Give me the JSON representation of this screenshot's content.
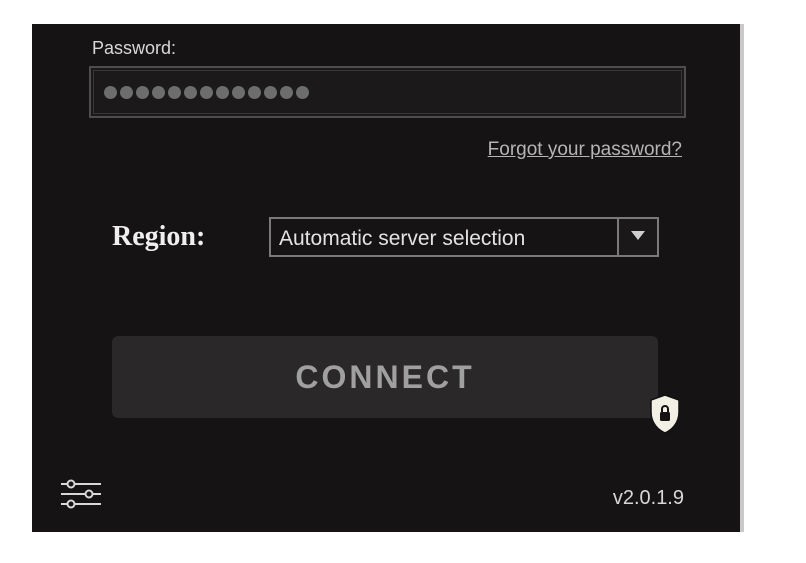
{
  "password": {
    "label": "Password:",
    "mask_length": 13,
    "forgot_link": "Forgot your password?"
  },
  "region": {
    "label": "Region:",
    "selected": "Automatic server selection"
  },
  "connect": {
    "label": "CONNECT"
  },
  "footer": {
    "version": "v2.0.1.9"
  },
  "icons": {
    "dropdown": "chevron-down-icon",
    "shield_lock": "lock-shield-icon",
    "settings": "settings-sliders-icon"
  }
}
